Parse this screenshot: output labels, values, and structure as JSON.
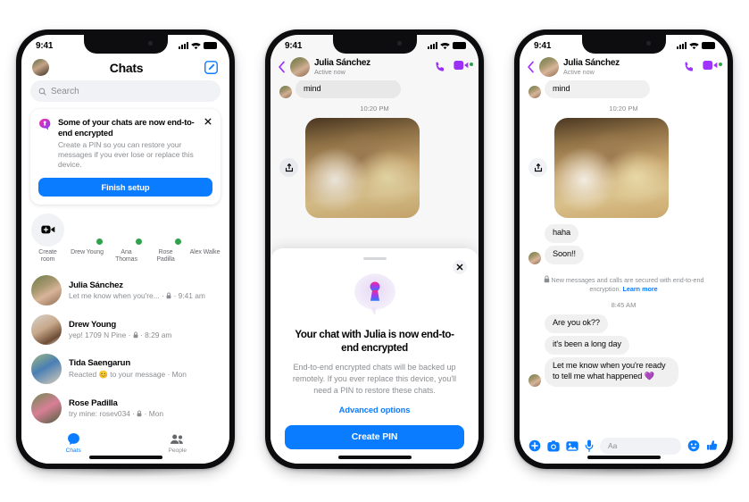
{
  "colors": {
    "messenger_blue": "#0a7cff",
    "online_green": "#31a24c",
    "purple_accent": "#a033ff",
    "bubble_gray": "#f0f0f0",
    "secondary_text": "#8a8d91"
  },
  "phone1": {
    "status": {
      "time": "9:41",
      "signal_icon": "cellular-bars-icon",
      "wifi_icon": "wifi-icon",
      "battery_icon": "battery-icon"
    },
    "header": {
      "avatar": "profile-avatar",
      "title": "Chats",
      "compose_icon": "compose-icon"
    },
    "search": {
      "placeholder": "Search",
      "icon": "search-icon"
    },
    "banner": {
      "icon": "encrypted-bubble-icon",
      "title": "Some of your chats are now end-to-end encrypted",
      "body": "Create a PIN so you can restore your messages if you ever lose or replace this device.",
      "button": "Finish setup",
      "close_icon": "close-icon"
    },
    "stories": [
      {
        "name": "Create room",
        "type": "create",
        "icon": "video-plus-icon",
        "online": false
      },
      {
        "name": "Drew Young",
        "type": "avatar",
        "avatar": "av-drew",
        "online": true
      },
      {
        "name": "Ana Thomas",
        "type": "avatar",
        "avatar": "av-ana",
        "online": true
      },
      {
        "name": "Rose Padilla",
        "type": "avatar",
        "avatar": "av-rose",
        "online": true
      },
      {
        "name": "Alex Walke",
        "type": "avatar",
        "avatar": "av-alex",
        "online": false
      }
    ],
    "chats": [
      {
        "name": "Julia Sánchez",
        "preview": "Let me know when you're... · \u0001 · 9:41 am",
        "avatar": "av-julia"
      },
      {
        "name": "Drew Young",
        "preview": "yep! 1709 N Pine · \u0001 · 8:29 am",
        "avatar": "av-drew"
      },
      {
        "name": "Tida Saengarun",
        "preview": "Reacted 😊 to your message · Mon",
        "avatar": "av-tida"
      },
      {
        "name": "Rose Padilla",
        "preview": "try mine: rosev034 · \u0001 · Mon",
        "avatar": "av-rose"
      }
    ],
    "tabs": [
      {
        "label": "Chats",
        "icon": "chat-bubble-icon",
        "active": true
      },
      {
        "label": "People",
        "icon": "people-icon",
        "active": false
      }
    ]
  },
  "phone2": {
    "status": {
      "time": "9:41"
    },
    "header": {
      "back_icon": "back-chevron-icon",
      "name": "Julia Sánchez",
      "status": "Active now",
      "call_icon": "phone-call-icon",
      "video_icon": "video-call-icon"
    },
    "thread": {
      "partial_bubble": "mind",
      "timestamp": "10:20 PM",
      "share_icon": "share-icon",
      "photo": "group-laughing-photo"
    },
    "sheet": {
      "handle": "drag-handle",
      "close_icon": "close-icon",
      "icon": "keyhole-bubble-icon",
      "title": "Your chat with Julia is now end-to-end encrypted",
      "body": "End-to-end encrypted chats will be backed up remotely. If you ever replace this device, you'll need a PIN to restore these chats.",
      "link": "Advanced options",
      "button": "Create PIN"
    }
  },
  "phone3": {
    "status": {
      "time": "9:41"
    },
    "header": {
      "back_icon": "back-chevron-icon",
      "name": "Julia Sánchez",
      "status": "Active now",
      "call_icon": "phone-call-icon",
      "video_icon": "video-call-icon"
    },
    "thread": {
      "partial_bubble": "mind",
      "timestamp_top": "10:20 PM",
      "share_icon": "share-icon",
      "photo": "group-laughing-photo",
      "messages_a": [
        {
          "text": "haha",
          "avatar": false
        },
        {
          "text": "Soon!!",
          "avatar": true
        }
      ],
      "encryption_notice": "New messages and calls are secured with end-to-end encryption.",
      "encryption_link": "Learn more",
      "lock_icon": "lock-icon",
      "timestamp_mid": "8:45 AM",
      "messages_b": [
        {
          "text": "Are you ok??",
          "avatar": false
        },
        {
          "text": "it's been a long day",
          "avatar": false
        },
        {
          "text": "Let me know when you're ready to tell me what happened 💜",
          "avatar": true
        }
      ]
    },
    "input": {
      "plus_icon": "plus-icon",
      "camera_icon": "camera-icon",
      "gallery_icon": "gallery-icon",
      "mic_icon": "microphone-icon",
      "placeholder": "Aa",
      "emoji_icon": "emoji-icon",
      "like_icon": "thumbs-up-icon"
    }
  }
}
